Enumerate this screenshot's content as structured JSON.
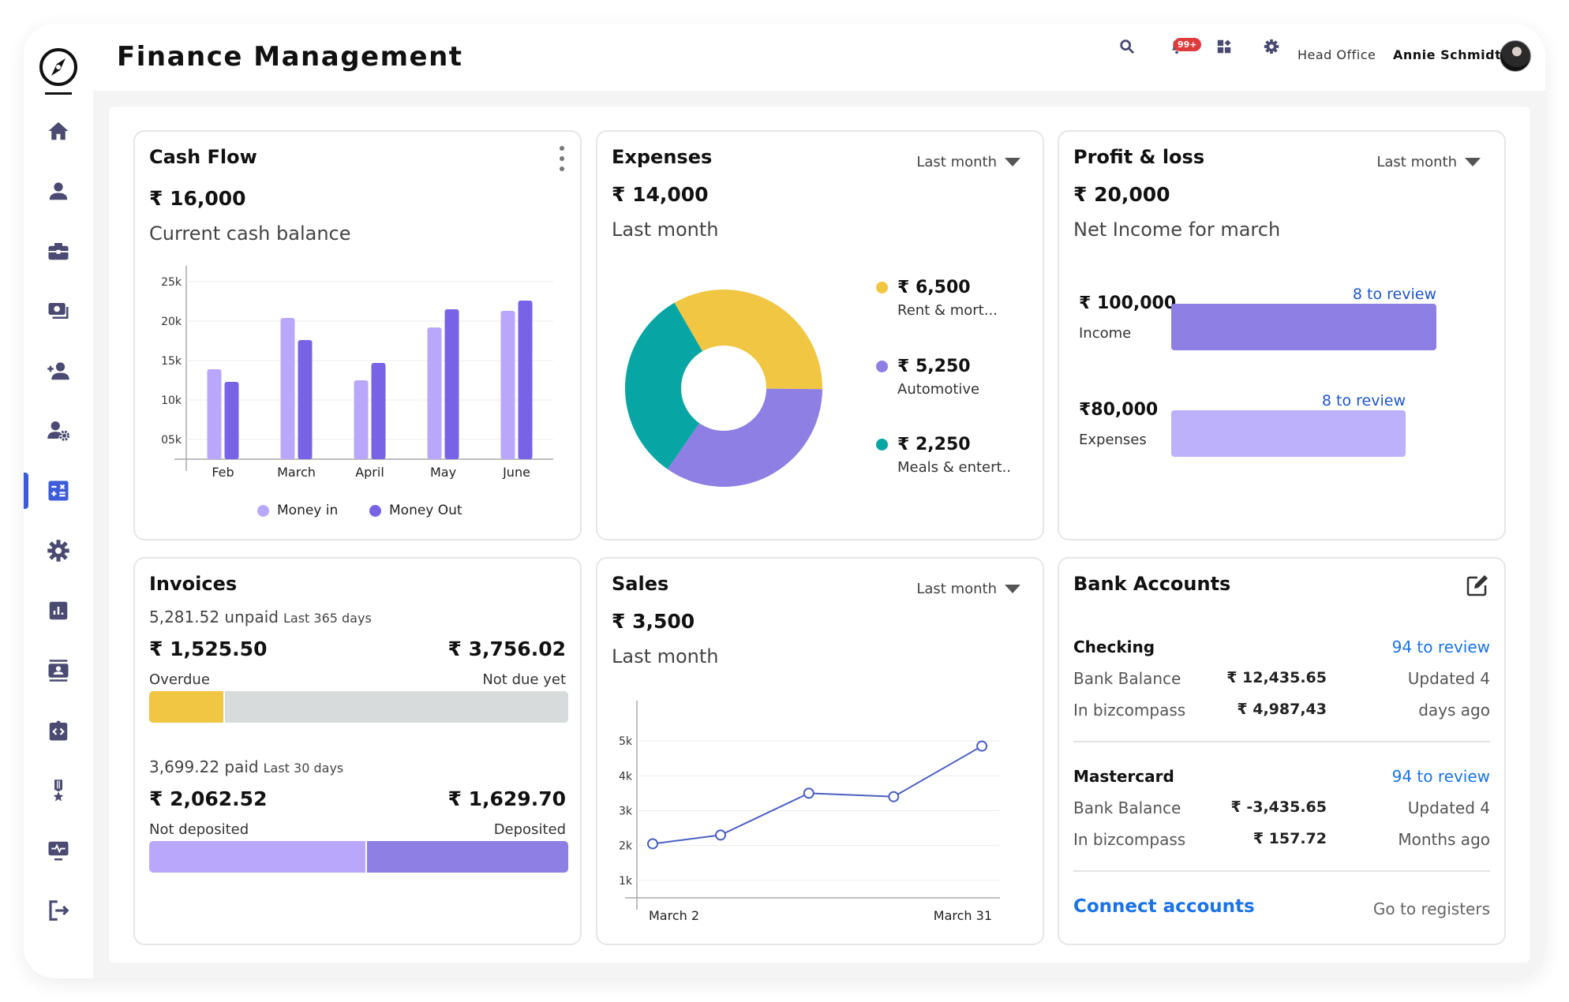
{
  "app": {
    "title": "Finance Management"
  },
  "header": {
    "notification_count": "99+",
    "office": "Head Office",
    "user_name": "Annie Schmidt",
    "icons": [
      "search-icon",
      "bell-icon",
      "widgets-icon",
      "gear-icon"
    ]
  },
  "sidebar": {
    "active_index": 6,
    "items": [
      {
        "name": "home",
        "icon": "home-icon"
      },
      {
        "name": "profile",
        "icon": "person-icon"
      },
      {
        "name": "jobs",
        "icon": "briefcase-icon"
      },
      {
        "name": "payments",
        "icon": "money-icon"
      },
      {
        "name": "add-user",
        "icon": "person-add-icon"
      },
      {
        "name": "user-settings",
        "icon": "person-gear-icon"
      },
      {
        "name": "finance",
        "icon": "calculator-icon"
      },
      {
        "name": "settings",
        "icon": "gear-icon"
      },
      {
        "name": "reports",
        "icon": "bar-chart-icon"
      },
      {
        "name": "contacts",
        "icon": "contact-card-icon"
      },
      {
        "name": "developer",
        "icon": "code-clipboard-icon"
      },
      {
        "name": "awards",
        "icon": "medal-icon"
      },
      {
        "name": "monitoring",
        "icon": "monitor-pulse-icon"
      },
      {
        "name": "logout",
        "icon": "logout-icon"
      }
    ],
    "colors": {
      "icon": "#4a4a72",
      "active": "#3d5bd9"
    }
  },
  "cash_flow": {
    "title": "Cash Flow",
    "amount": "₹ 16,000",
    "subtitle": "Current cash balance",
    "legend": {
      "in": "Money in",
      "out": "Money Out"
    },
    "colors": {
      "in": "#b9a7fb",
      "out": "#7863e6"
    }
  },
  "expenses": {
    "title": "Expenses",
    "period": "Last month",
    "amount": "₹ 14,000",
    "subtitle": "Last month",
    "items": [
      {
        "amount": "₹ 6,500",
        "label": "Rent & mort...",
        "color": "#f0c642"
      },
      {
        "amount": "₹ 5,250",
        "label": "Automotive",
        "color": "#8d7fe3"
      },
      {
        "amount": "₹ 2,250",
        "label": "Meals & entert..",
        "color": "#07a6a4"
      }
    ]
  },
  "profit_loss": {
    "title": "Profit & loss",
    "period": "Last month",
    "amount": "₹ 20,000",
    "subtitle": "Net Income for march",
    "rows": [
      {
        "amount": "₹ 100,000",
        "label": "Income",
        "review": "8 to review",
        "value": 100000,
        "color": "#8d7fe3"
      },
      {
        "amount": "₹80,000",
        "label": "Expenses",
        "review": "8 to review",
        "value": 80000,
        "color": "#bdb1fb"
      }
    ]
  },
  "invoices": {
    "title": "Invoices",
    "unpaid": {
      "amount": "5,281.52 unpaid",
      "range": "Last 365 days",
      "left_amount": "₹ 1,525.50",
      "left_label": "Overdue",
      "right_amount": "₹ 3,756.02",
      "right_label": "Not due yet",
      "left_share": 0.18,
      "left_color": "#f0c642",
      "right_color": "#d8dbdb"
    },
    "paid": {
      "amount": "3,699.22 paid",
      "range": "Last 30 days",
      "left_amount": "₹ 2,062.52",
      "left_label": "Not deposited",
      "right_amount": "₹ 1,629.70",
      "right_label": "Deposited",
      "left_share": 0.52,
      "left_color": "#b9a7fb",
      "right_color": "#8d7fe3"
    }
  },
  "sales": {
    "title": "Sales",
    "period": "Last month",
    "amount": "₹ 3,500",
    "subtitle": "Last month"
  },
  "bank_accounts": {
    "title": "Bank Accounts",
    "accounts": [
      {
        "name": "Checking",
        "review": "94 to review",
        "balance_label": "Bank Balance",
        "balance": "₹ 12,435.65",
        "biz_label": "In bizcompass",
        "biz": "₹ 4,987,43",
        "updated_1": "Updated 4",
        "updated_2": "days ago"
      },
      {
        "name": "Mastercard",
        "review": "94 to review",
        "balance_label": "Bank Balance",
        "balance": "₹ -3,435.65",
        "biz_label": "In bizcompass",
        "biz": "₹ 157.72",
        "updated_1": "Updated 4",
        "updated_2": "Months ago"
      }
    ],
    "connect": "Connect accounts",
    "registers": "Go to registers"
  },
  "chart_data": [
    {
      "type": "bar",
      "title": "Cash Flow",
      "categories": [
        "Feb",
        "March",
        "April",
        "May",
        "June"
      ],
      "series": [
        {
          "name": "Money in",
          "values": [
            13900,
            20400,
            12500,
            19200,
            21300
          ]
        },
        {
          "name": "Money Out",
          "values": [
            12300,
            17600,
            14700,
            21500,
            22600
          ]
        }
      ],
      "yticks": [
        "05k",
        "10k",
        "15k",
        "20k",
        "25k"
      ],
      "ytick_values": [
        5000,
        10000,
        15000,
        20000,
        25000
      ],
      "ylim": [
        2500,
        26500
      ],
      "grid": true,
      "legend": "bottom"
    },
    {
      "type": "pie",
      "title": "Expenses",
      "labels": [
        "Rent & mort...",
        "Automotive",
        "Meals & entert.."
      ],
      "values": [
        6500,
        5250,
        2250
      ],
      "visual_share": [
        0.335,
        0.345,
        0.32
      ],
      "start_angle_deg": -30,
      "donut": true,
      "legend": "right"
    },
    {
      "type": "line",
      "title": "Sales",
      "x": [
        "March 2",
        "",
        "",
        "",
        "March 31"
      ],
      "values": [
        2050,
        2300,
        3500,
        3400,
        4850
      ],
      "x_positions": [
        0,
        0.2,
        0.46,
        0.71,
        0.97
      ],
      "yticks": [
        "1k",
        "2k",
        "3k",
        "4k",
        "5k"
      ],
      "ytick_values": [
        1000,
        2000,
        3000,
        4000,
        5000
      ],
      "ylim": [
        500,
        5250
      ],
      "grid": true,
      "color": "#4a5fc1"
    }
  ]
}
